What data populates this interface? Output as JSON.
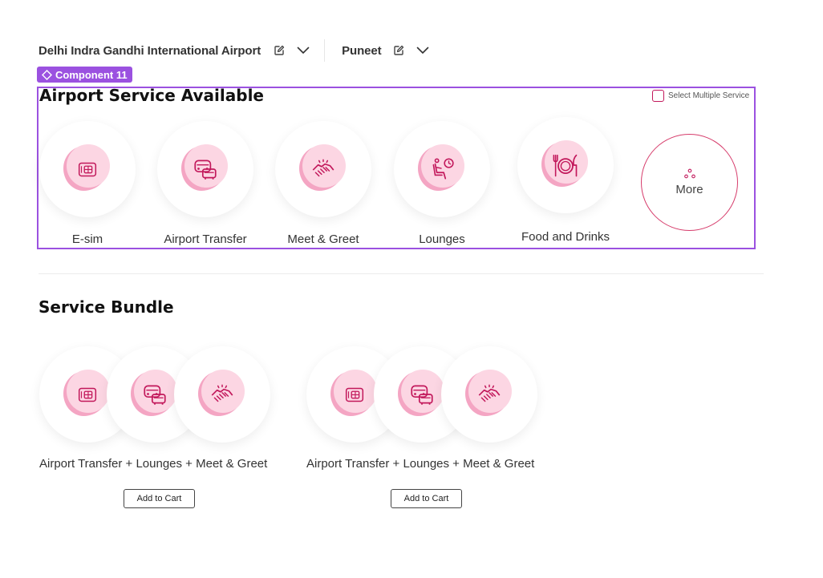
{
  "header": {
    "location": "Delhi Indra Gandhi International Airport",
    "user": "Puneet"
  },
  "component_tag": "Component 11",
  "services_section": {
    "title": "Airport Service Available",
    "select_multiple_label": "Select Multiple Service",
    "items": [
      {
        "label": "E-sim",
        "icon": "sim-card-icon"
      },
      {
        "label": "Airport Transfer",
        "icon": "car-transfer-icon"
      },
      {
        "label": "Meet & Greet",
        "icon": "handshake-icon"
      },
      {
        "label": "Lounges",
        "icon": "lounge-seat-icon"
      },
      {
        "label": "Food and Drinks",
        "icon": "fork-plate-knife-icon"
      }
    ],
    "more_label": "More"
  },
  "bundle_section": {
    "title": "Service Bundle",
    "bundles": [
      {
        "label": "Airport Transfer + Lounges + Meet & Greet",
        "button": "Add to Cart",
        "icons": [
          "sim-card-icon",
          "car-transfer-icon",
          "handshake-icon"
        ]
      },
      {
        "label": "Airport Transfer + Lounges + Meet & Greet",
        "button": "Add to Cart",
        "icons": [
          "sim-card-icon",
          "car-transfer-icon",
          "handshake-icon"
        ]
      }
    ]
  },
  "colors": {
    "accent_purple": "#9b51e0",
    "icon_stroke": "#c2185b",
    "blob_pink": "#f4a5c3",
    "blob_light_pink": "#fcd6e3"
  }
}
